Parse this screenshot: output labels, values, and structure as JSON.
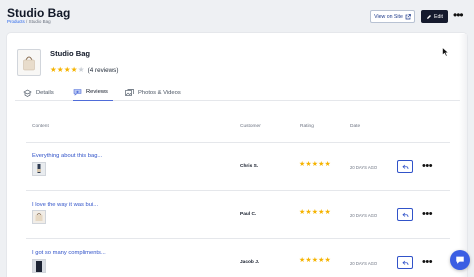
{
  "header": {
    "title": "Studio Bag",
    "breadcrumb": {
      "parent": "Products",
      "separator": "/",
      "current": "Studio Bag"
    },
    "view_on_site_label": "View on Site",
    "edit_label": "Edit",
    "more_label": "•••"
  },
  "product": {
    "name": "Studio Bag",
    "rating": 4,
    "rating_max": 5,
    "stars_filled": "★★★★",
    "stars_empty": "★",
    "reviews_count_label": "(4 reviews)"
  },
  "tabs": [
    {
      "label": "Details",
      "icon": "details-icon",
      "active": false
    },
    {
      "label": "Reviews",
      "icon": "reviews-icon",
      "active": true
    },
    {
      "label": "Photos & Videos",
      "icon": "photos-icon",
      "active": false
    }
  ],
  "table": {
    "columns": {
      "content": "Content",
      "customer": "Customer",
      "rating": "Rating",
      "date": "Date"
    },
    "rows": [
      {
        "title": "Everything about this bag...",
        "customer": "Chris S.",
        "rating": 5,
        "stars": "★★★★★",
        "date": "20 DAYS AGO",
        "more": "•••"
      },
      {
        "title": "I love the way it was bui...",
        "customer": "Paul C.",
        "rating": 5,
        "stars": "★★★★★",
        "date": "20 DAYS AGO",
        "more": "•••"
      },
      {
        "title": "I got so many compliments...",
        "customer": "Jacob J.",
        "rating": 5,
        "stars": "★★★★★",
        "date": "20 DAYS AGO",
        "more": "•••"
      }
    ]
  },
  "colors": {
    "accent": "#3153c9",
    "star": "#f5b301",
    "edit_button": "#151a2d",
    "chat_button": "#3b5ee3"
  }
}
